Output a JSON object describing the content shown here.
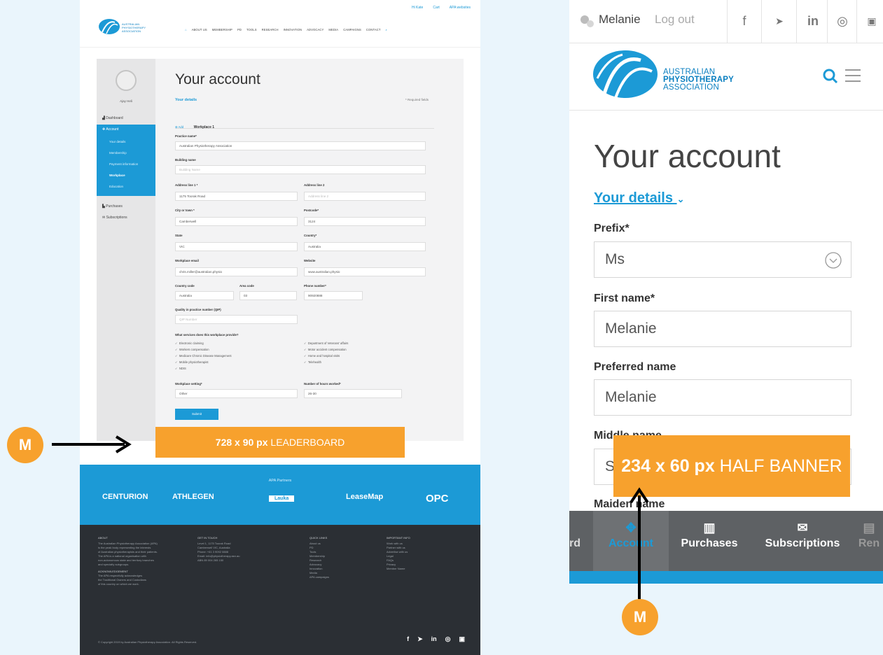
{
  "desktop": {
    "utility": {
      "login": "Hi Kate",
      "cart": "Cart",
      "apa_websites": "APA websites"
    },
    "nav": [
      "ABOUT US",
      "MEMBERSHIP",
      "PD",
      "TOOLS",
      "RESEARCH",
      "INNOVATION",
      "ADVOCACY",
      "MEDIA",
      "CAMPAIGNS",
      "CONTACT"
    ],
    "sidebar": {
      "user_name": "Ajay Heli",
      "items": [
        "Dashboard",
        "Account",
        "Purchases",
        "Subscriptions"
      ],
      "account_sub": [
        "Your details",
        "Membership",
        "Payment information",
        "Workplace",
        "Education"
      ]
    },
    "main": {
      "title": "Your account",
      "your_details": "Your details",
      "required": "* Required fields",
      "tab_add": "Add",
      "workplace_tab": "Workplace 1",
      "practice_name_label": "Practice name*",
      "practice_name": "Australian Physiotherapy Association",
      "building_label": "Building name",
      "building_ph": "Building Name",
      "addr1_label": "Address line 1 *",
      "addr1": "1175 Toorak Road",
      "addr2_label": "Address line 2",
      "addr2_ph": "Address line 2",
      "city_label": "City or town *",
      "city": "Camberwell",
      "postcode_label": "Postcode*",
      "postcode": "3124",
      "state_label": "State",
      "state": "VIC",
      "country_label": "Country*",
      "country": "Australia",
      "wemail_label": "Workplace email",
      "wemail": "chris.miller@australian.physio",
      "website_label": "Website",
      "website": "www.australian.physio",
      "ccode_label": "Country code",
      "ccode": "Australia",
      "area_label": "Area code",
      "area": "03",
      "phone_label": "Phone number*",
      "phone": "90920888",
      "qip_label": "Quality in practice number (QIP)",
      "qip_ph": "QIP Number",
      "services_label": "What services does this workplace provide?",
      "services_left": [
        "Electronic claiming",
        "Workers compensation",
        "Medicare Chronic Disease Management",
        "Mobile physiotherapist",
        "NDIS"
      ],
      "services_right": [
        "Department of Veterans' affairs",
        "Motor accident compensation",
        "Home and hospital visits",
        "Telehealth"
      ],
      "setting_label": "Workplace setting*",
      "setting": "Other",
      "hours_label": "Number of hours worked*",
      "hours": "26-30",
      "submit": "Submit"
    },
    "leaderboard": {
      "size": "728 x 90 px",
      "label": "LEADERBOARD"
    },
    "partners": {
      "title": "APA Partners",
      "logos": [
        "CENTURION",
        "ATHLEGEN",
        "Lauka",
        "LeaseMap",
        "OPC"
      ]
    },
    "footer": {
      "cols": [
        {
          "title": "ABOUT",
          "lines": [
            "The Australian Physiotherapy Association (APA)",
            "is the peak body representing the interests",
            "of Australian physiotherapists and their patients.",
            "The APA is a national organisation with",
            "non-autonomous state and territory branches",
            "and specialty subgroups."
          ]
        },
        {
          "title": "GET IN TOUCH",
          "lines": [
            "Level 1, 1175 Toorak Road",
            "Camberwell VIC, Australia",
            "Phone: +61 3 9092 0888",
            "Email: info@physiotherapy.asn.au",
            "",
            "ABN 89 004 265 150"
          ]
        },
        {
          "title": "QUICK LINKS",
          "lines": [
            "About us",
            "PD",
            "Tools",
            "Membership",
            "Research",
            "Advocacy",
            "Innovation",
            "Media",
            "APA campaigns"
          ]
        },
        {
          "title": "IMPORTANT INFO",
          "lines": [
            "Work with us",
            "Partner with us",
            "Advertise with us",
            "Legal",
            "FAQs",
            "Privacy",
            "Member Name"
          ]
        }
      ],
      "ack_title": "ACKNOWLEDGEMENT",
      "ack": [
        "The APA respectfully acknowledges",
        "the Traditional Owners and Custodians",
        "of this country on which we work."
      ],
      "copyright": "© Copyright 2019 by Australian Physiotherapy Association. All Rights Reserved.",
      "social": [
        "f",
        "t",
        "in",
        "ig",
        "yt"
      ]
    }
  },
  "mobile": {
    "user": "Melanie",
    "logout": "Log out",
    "brand": [
      "AUSTRALIAN",
      "PHYSIOTHERAPY",
      "ASSOCIATION"
    ],
    "title": "Your account",
    "your_details": "Your details",
    "fields": [
      {
        "label": "Prefix*",
        "value": "Ms"
      },
      {
        "label": "First name*",
        "value": "Melanie"
      },
      {
        "label": "Preferred name",
        "value": "Melanie"
      },
      {
        "label": "Middle name",
        "value": "S"
      },
      {
        "label": "Maiden name",
        "value": ""
      }
    ],
    "tabs": [
      "rd",
      "Account",
      "Purchases",
      "Subscriptions",
      "Ren"
    ],
    "half_banner": {
      "size": "234 x 60 px",
      "label": "HALF BANNER"
    }
  },
  "markers": [
    "M",
    "M"
  ],
  "colors": {
    "accent": "#1c9ad6",
    "ad": "#f7a12d",
    "footer": "#2b2f34",
    "background": "#eaf5fc"
  }
}
